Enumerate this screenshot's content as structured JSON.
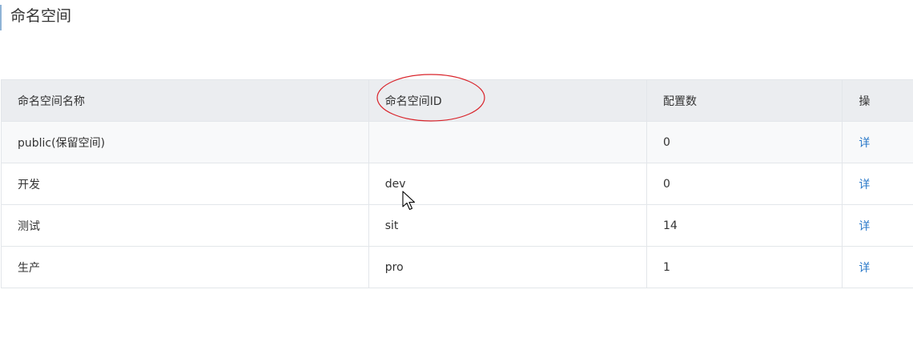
{
  "page": {
    "title": "命名空间"
  },
  "table": {
    "headers": {
      "name": "命名空间名称",
      "id": "命名空间ID",
      "count": "配置数",
      "operation": "操"
    },
    "rows": [
      {
        "name": "public(保留空间)",
        "id": "",
        "count": "0",
        "action": "详"
      },
      {
        "name": "开发",
        "id": "dev",
        "count": "0",
        "action": "详"
      },
      {
        "name": "测试",
        "id": "sit",
        "count": "14",
        "action": "详"
      },
      {
        "name": "生产",
        "id": "pro",
        "count": "1",
        "action": "详"
      }
    ]
  },
  "colors": {
    "header_bg": "#ebedf0",
    "border": "#e3e6ea",
    "link": "#2a79c9",
    "annotation": "#d9232a"
  }
}
